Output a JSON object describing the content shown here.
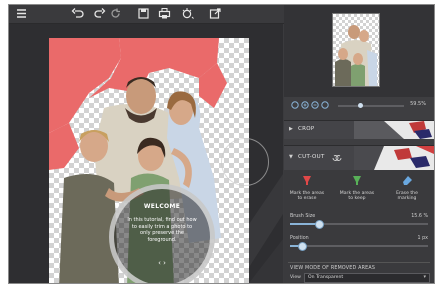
{
  "toolbar": {
    "icons": [
      "menu-icon",
      "undo-icon",
      "redo-icon",
      "reset-icon",
      "save-icon",
      "print-icon",
      "effects-icon",
      "export-icon"
    ]
  },
  "welcome": {
    "title": "WELCOME",
    "body": "In this tutorial, find out how to easily trim a photo to only preserve the foreground.",
    "nav": "‹   ›"
  },
  "panel": {
    "zoom_value": "59.5%",
    "crop_label": "CROP",
    "cutout_label": "CUT-OUT",
    "tools": [
      {
        "label": "Mark the areas to erase",
        "color": "#e04848"
      },
      {
        "label": "Mark the areas to keep",
        "color": "#58b058"
      },
      {
        "label": "Erase the marking",
        "color": "#6aa8e0"
      }
    ],
    "brush_size_label": "Brush Size",
    "brush_size_value": "15.6 %",
    "position_label": "Position",
    "position_value": "1 px",
    "view_mode_heading": "VIEW MODE OF REMOVED AREAS",
    "view_label": "View",
    "view_value": "On Transparent",
    "brush_size_level": 0.2,
    "position_level": 0.08
  },
  "colors": {
    "erase_overlay": "#ea6a6a",
    "accent": "#8ab4d8"
  }
}
